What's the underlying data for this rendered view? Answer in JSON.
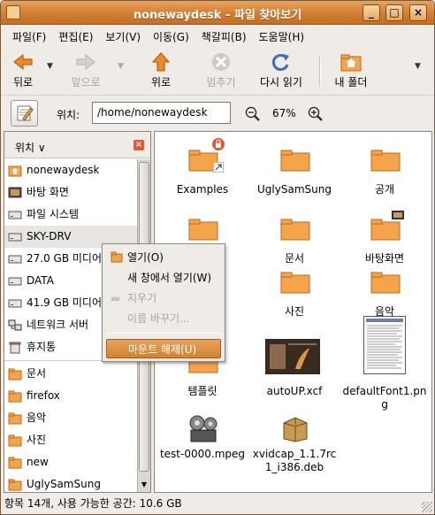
{
  "window": {
    "title": "nonewaydesk - 파일 찾아보기"
  },
  "menubar": [
    "파일(F)",
    "편집(E)",
    "보기(V)",
    "이동(G)",
    "책갈피(B)",
    "도움말(H)"
  ],
  "toolbar": {
    "back": "뒤로",
    "forward": "앞으로",
    "up": "위로",
    "stop": "멈추기",
    "reload": "다시 읽기",
    "home": "내 폴더"
  },
  "location": {
    "label": "위치:",
    "path": "/home/nonewaydesk",
    "zoom": "67%"
  },
  "sidebar": {
    "header": "위치",
    "places": [
      "nonewaydesk",
      "바탕 화면",
      "파일 시스템",
      "SKY-DRV",
      "27.0 GB 미디어",
      "DATA",
      "41.9 GB 미디어",
      "네트워크 서버",
      "휴지통"
    ],
    "bookmarks": [
      "문서",
      "firefox",
      "음악",
      "사진",
      "new",
      "UglySamSung"
    ]
  },
  "files": [
    "Examples",
    "UglySamSung",
    "공개",
    "",
    "문서",
    "바탕화면",
    "",
    "사진",
    "음악",
    "템플릿",
    "autoUP.xcf",
    "defaultFont1.png",
    "test-0000.mpeg",
    "xvidcap_1.1.7rc1_i386.deb"
  ],
  "context_menu": {
    "open": "열기(O)",
    "open_new_window": "새 창에서 열기(W)",
    "delete": "지우기",
    "rename": "이름 바꾸기...",
    "unmount": "마운트 해제(U)"
  },
  "status": "항목 14개, 사용 가능한 공간: 10.6 GB",
  "colors": {
    "accent": "#d27f31",
    "folder": "#f5a44a"
  }
}
